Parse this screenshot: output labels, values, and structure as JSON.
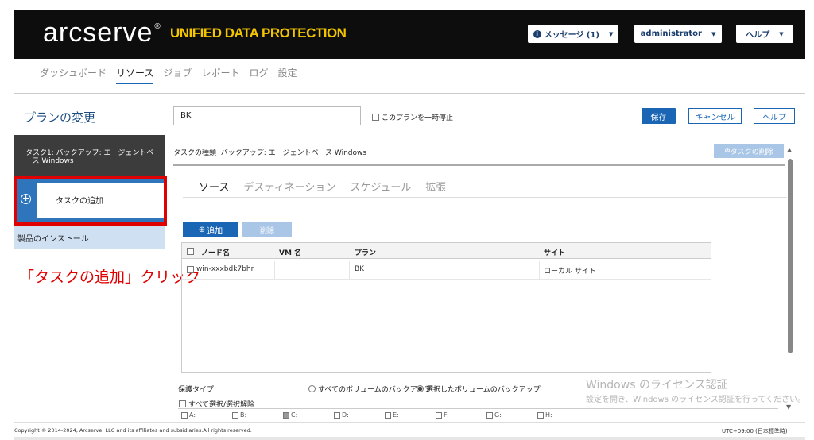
{
  "header": {
    "logo": "arcserve",
    "logo_mark": "®",
    "product": "UNIFIED DATA PROTECTION",
    "messages_label": "メッセージ (1)",
    "user_label": "administrator",
    "help_label": "ヘルプ"
  },
  "nav": {
    "items": [
      "ダッシュボード",
      "リソース",
      "ジョブ",
      "レポート",
      "ログ",
      "設定"
    ]
  },
  "page": {
    "title": "プランの変更",
    "plan_name_value": "BK",
    "pause_label": "このプランを一時停止",
    "save_label": "保存",
    "cancel_label": "キャンセル",
    "help_label": "ヘルプ"
  },
  "sidebar": {
    "task1_label": "タスク1: バックアップ: エージェントベース Windows",
    "add_task_label": "タスクの追加",
    "install_label": "製品のインストール"
  },
  "annotation": "「タスクの追加」クリック",
  "task": {
    "type_label": "タスクの種類",
    "type_value": "バックアップ: エージェントベース Windows",
    "delete_label": "タスクの削除",
    "tabs": [
      "ソース",
      "デスティネーション",
      "スケジュール",
      "拡張"
    ]
  },
  "source": {
    "add_label": "追加",
    "remove_label": "削除",
    "columns": [
      "ノード名",
      "VM 名",
      "プラン",
      "サイト"
    ],
    "rows": [
      {
        "node": "win-xxxbdk7bhr",
        "vm": "",
        "plan": "BK",
        "site": "ローカル サイト"
      }
    ]
  },
  "protection": {
    "type_label": "保護タイプ",
    "all_volumes_label": "すべてのボリュームのバックアップ",
    "selected_volumes_label": "選択したボリュームのバックアップ",
    "select_all_label": "すべて選択/選択解除",
    "volumes": [
      "A:",
      "B:",
      "C:",
      "D:",
      "E:",
      "F:",
      "G:",
      "H:"
    ],
    "checked_volume": "C:"
  },
  "watermark": {
    "title": "Windows のライセンス認証",
    "body": "設定を開き、Windows のライセンス認証を行ってください。"
  },
  "footer": {
    "copyright": "Copyright © 2014-2024, Arcserve, LLC and its affiliates and subsidiaries.All rights reserved.",
    "timezone": "UTC+09:00 (日本標準時)"
  },
  "colors": {
    "brand_yellow": "#f2c500",
    "accent_blue": "#1a66b5",
    "annotation_red": "#e00000"
  }
}
